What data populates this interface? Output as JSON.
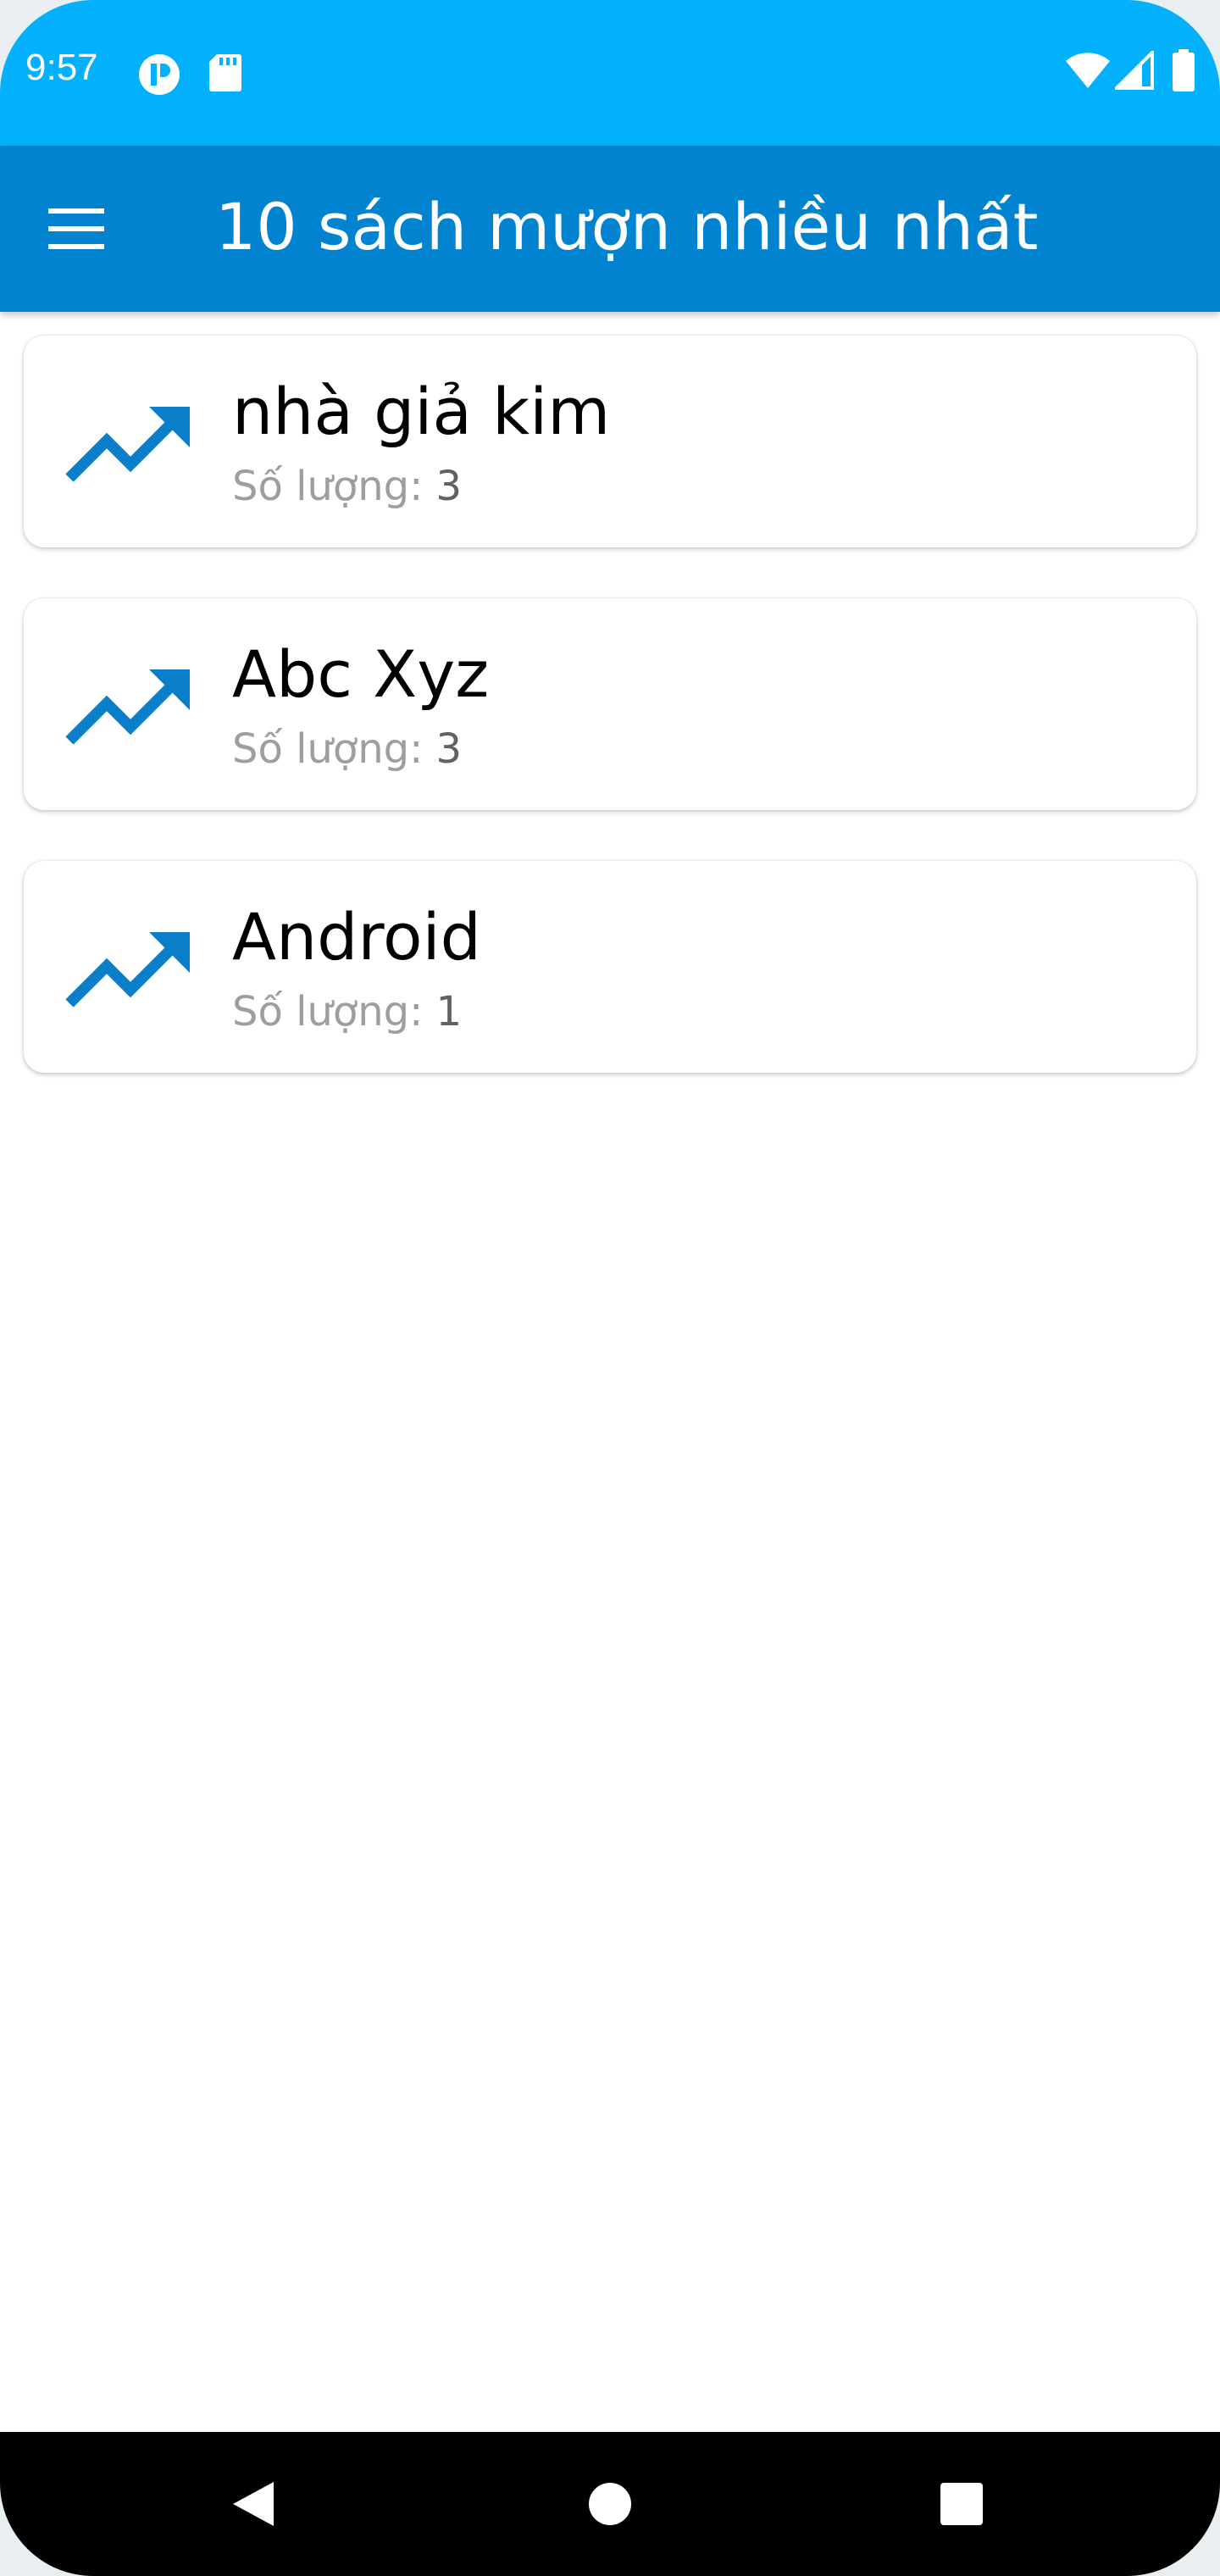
{
  "status_bar": {
    "time": "9:57",
    "icons": [
      "app-notification-icon",
      "sd-card-icon",
      "wifi-icon",
      "cell-signal-icon",
      "battery-icon"
    ]
  },
  "app_bar": {
    "menu_icon": "hamburger-menu-icon",
    "title": "10 sách mượn nhiều nhất"
  },
  "books": [
    {
      "title": "nhà giả kim",
      "qty_label": "Số lượng:",
      "qty": "3"
    },
    {
      "title": "Abc Xyz",
      "qty_label": "Số lượng:",
      "qty": "3"
    },
    {
      "title": "Android",
      "qty_label": "Số lượng:",
      "qty": "1"
    }
  ],
  "nav_bar": {
    "icons": [
      "back-icon",
      "home-icon",
      "recents-icon"
    ]
  },
  "colors": {
    "status_bar": "#03b0fb",
    "app_bar": "#0283cf",
    "accent_icon": "#0a7ec8",
    "secondary_text": "#9e9e9e"
  }
}
